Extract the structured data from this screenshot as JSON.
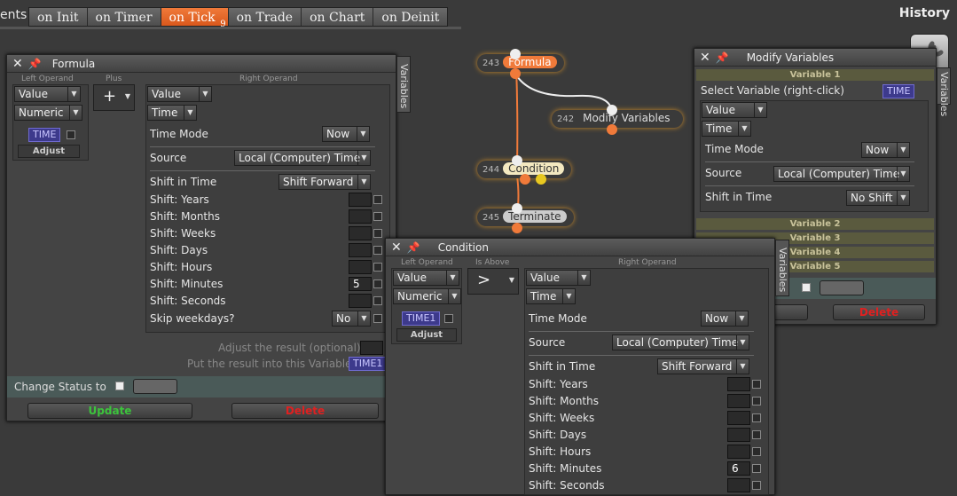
{
  "topbar": {
    "events_label": "ents",
    "tabs": [
      {
        "label": "on Init"
      },
      {
        "label": "on Timer"
      },
      {
        "label": "on Tick",
        "sub": "9"
      },
      {
        "label": "on Trade"
      },
      {
        "label": "on Chart"
      },
      {
        "label": "on Deinit"
      }
    ],
    "history": "History"
  },
  "formula": {
    "title": "Formula",
    "variables_tab": "Variables",
    "left_operand_hdr": "Left Operand",
    "plus_hdr": "Plus",
    "right_operand_hdr": "Right Operand",
    "left_value": "Value",
    "left_type": "Numeric",
    "left_var": "TIME",
    "adjust": "Adjust",
    "plus_symbol": "+",
    "right_value": "Value",
    "right_type": "Time",
    "rows": {
      "time_mode_label": "Time Mode",
      "time_mode": "Now",
      "source_label": "Source",
      "source": "Local (Computer) Time",
      "shift_label": "Shift in Time",
      "shift": "Shift Forward",
      "years": "Shift: Years",
      "months": "Shift: Months",
      "weeks": "Shift: Weeks",
      "days": "Shift: Days",
      "hours": "Shift: Hours",
      "minutes": "Shift: Minutes",
      "minutes_value": "5",
      "seconds": "Shift: Seconds",
      "skip_label": "Skip weekdays?",
      "skip": "No"
    },
    "adjust_result": "Adjust the result (optional):",
    "put_result": "Put the result into this Variable:",
    "result_var": "TIME1",
    "change_status": "Change Status to",
    "update": "Update",
    "delete": "Delete"
  },
  "nodes": {
    "formula": {
      "num": "243",
      "name": "Formula"
    },
    "modify": {
      "num": "242",
      "name": "Modify Variables"
    },
    "condition": {
      "num": "244",
      "name": "Condition"
    },
    "terminate": {
      "num": "245",
      "name": "Terminate"
    }
  },
  "modify": {
    "title": "Modify Variables",
    "variables_tab": "Variables",
    "variable1": "Variable 1",
    "select_label": "Select Variable (right-click)",
    "select_var": "TIME",
    "value": "Value",
    "type": "Time",
    "time_mode_label": "Time Mode",
    "time_mode": "Now",
    "source_label": "Source",
    "source": "Local (Computer) Time",
    "shift_label": "Shift in Time",
    "shift": "No Shift",
    "variable2": "Variable 2",
    "variable3": "Variable 3",
    "variable4": "Variable 4",
    "variable5": "Variable 5",
    "delete": "Delete"
  },
  "condition": {
    "title": "Condition",
    "variables_tab": "Variables",
    "left_operand_hdr": "Left Operand",
    "op_hdr": "Is Above",
    "right_operand_hdr": "Right Operand",
    "left_value": "Value",
    "left_type": "Numeric",
    "left_var": "TIME1",
    "adjust": "Adjust",
    "op_symbol": ">",
    "right_value": "Value",
    "right_type": "Time",
    "rows": {
      "time_mode_label": "Time Mode",
      "time_mode": "Now",
      "source_label": "Source",
      "source": "Local (Computer) Time",
      "shift_label": "Shift in Time",
      "shift": "Shift Forward",
      "years": "Shift: Years",
      "months": "Shift: Months",
      "weeks": "Shift: Weeks",
      "days": "Shift: Days",
      "hours": "Shift: Hours",
      "minutes": "Shift: Minutes",
      "minutes_value": "6",
      "seconds": "Shift: Seconds"
    }
  },
  "colors": {
    "accent_orange": "#f07a3a",
    "update_green": "#3cc43c",
    "delete_red": "#e02020",
    "variable_badge": "#3d3a8c"
  }
}
